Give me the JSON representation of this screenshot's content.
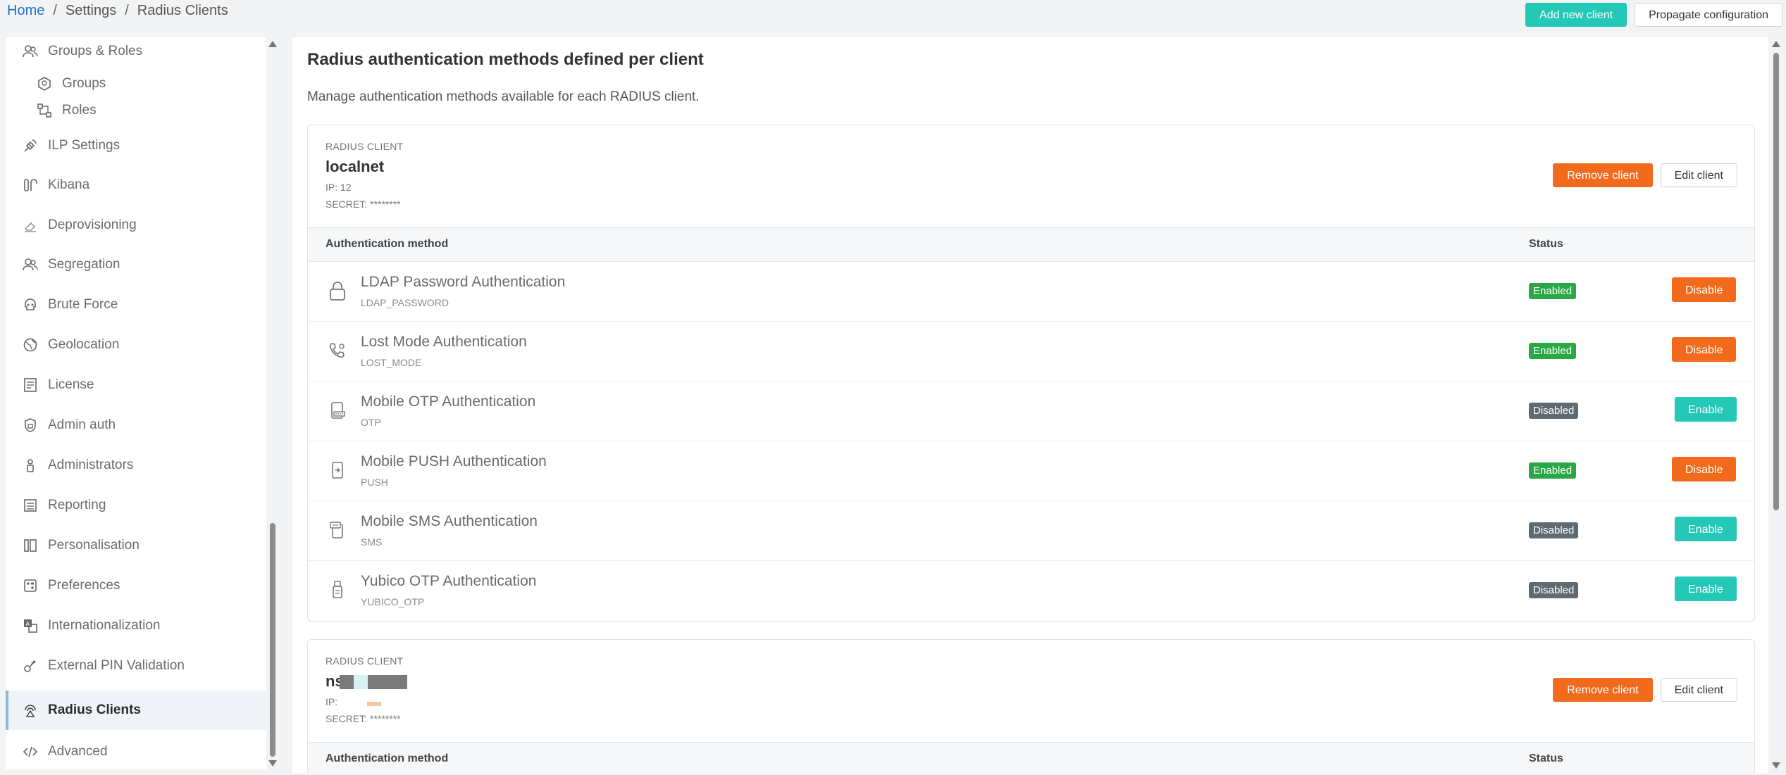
{
  "breadcrumb": {
    "home": "Home",
    "settings": "Settings",
    "current": "Radius Clients",
    "separator": "/"
  },
  "top_actions": {
    "add_client": "Add new client",
    "propagate": "Propagate configuration"
  },
  "sidebar": {
    "items": [
      {
        "label": "Groups & Roles",
        "icon": "users-icon",
        "sub": false
      },
      {
        "label": "Groups",
        "icon": "group-icon",
        "sub": true
      },
      {
        "label": "Roles",
        "icon": "roles-icon",
        "sub": true
      },
      {
        "label": "ILP Settings",
        "icon": "satellite-icon",
        "sub": false
      },
      {
        "label": "Kibana",
        "icon": "kibana-icon",
        "sub": false
      },
      {
        "label": "Deprovisioning",
        "icon": "eraser-icon",
        "sub": false
      },
      {
        "label": "Segregation",
        "icon": "users-icon",
        "sub": false
      },
      {
        "label": "Brute Force",
        "icon": "skull-icon",
        "sub": false
      },
      {
        "label": "Geolocation",
        "icon": "globe-icon",
        "sub": false
      },
      {
        "label": "License",
        "icon": "license-icon",
        "sub": false
      },
      {
        "label": "Admin auth",
        "icon": "shield-icon",
        "sub": false
      },
      {
        "label": "Administrators",
        "icon": "admin-icon",
        "sub": false
      },
      {
        "label": "Reporting",
        "icon": "report-icon",
        "sub": false
      },
      {
        "label": "Personalisation",
        "icon": "columns-icon",
        "sub": false
      },
      {
        "label": "Preferences",
        "icon": "preferences-icon",
        "sub": false
      },
      {
        "label": "Internationalization",
        "icon": "translate-icon",
        "sub": false
      },
      {
        "label": "External PIN Validation",
        "icon": "key-icon",
        "sub": false
      },
      {
        "label": "Radius Clients",
        "icon": "radius-icon",
        "sub": false,
        "active": true
      },
      {
        "label": "Advanced",
        "icon": "code-icon",
        "sub": false
      }
    ]
  },
  "main": {
    "title": "Radius authentication methods defined per client",
    "description": "Manage authentication methods available for each RADIUS client."
  },
  "clients": [
    {
      "label": "RADIUS CLIENT",
      "name": "localnet",
      "ip": "IP: 12",
      "secret": "SECRET: ********",
      "remove": "Remove client",
      "edit": "Edit client",
      "th_method": "Authentication method",
      "th_status": "Status",
      "methods": [
        {
          "name": "LDAP Password Authentication",
          "code": "LDAP_PASSWORD",
          "status": "Enabled",
          "action": "Disable",
          "icon": "lock-icon"
        },
        {
          "name": "Lost Mode Authentication",
          "code": "LOST_MODE",
          "status": "Enabled",
          "action": "Disable",
          "icon": "phone-icon"
        },
        {
          "name": "Mobile OTP Authentication",
          "code": "OTP",
          "status": "Disabled",
          "action": "Enable",
          "icon": "mobile-otp-icon"
        },
        {
          "name": "Mobile PUSH Authentication",
          "code": "PUSH",
          "status": "Enabled",
          "action": "Disable",
          "icon": "mobile-push-icon"
        },
        {
          "name": "Mobile SMS Authentication",
          "code": "SMS",
          "status": "Disabled",
          "action": "Enable",
          "icon": "sms-icon"
        },
        {
          "name": "Yubico OTP Authentication",
          "code": "YUBICO_OTP",
          "status": "Disabled",
          "action": "Enable",
          "icon": "usb-key-icon"
        }
      ]
    },
    {
      "label": "RADIUS CLIENT",
      "name": "ns",
      "ip": "IP:",
      "secret": "SECRET: ********",
      "remove": "Remove client",
      "edit": "Edit client",
      "th_method": "Authentication method",
      "th_status": "Status"
    }
  ],
  "colors": {
    "accent_teal": "#23c8b6",
    "accent_orange": "#f26a1b",
    "enabled": "#2aa845",
    "disabled": "#5f6a72",
    "link": "#1a73c9"
  }
}
